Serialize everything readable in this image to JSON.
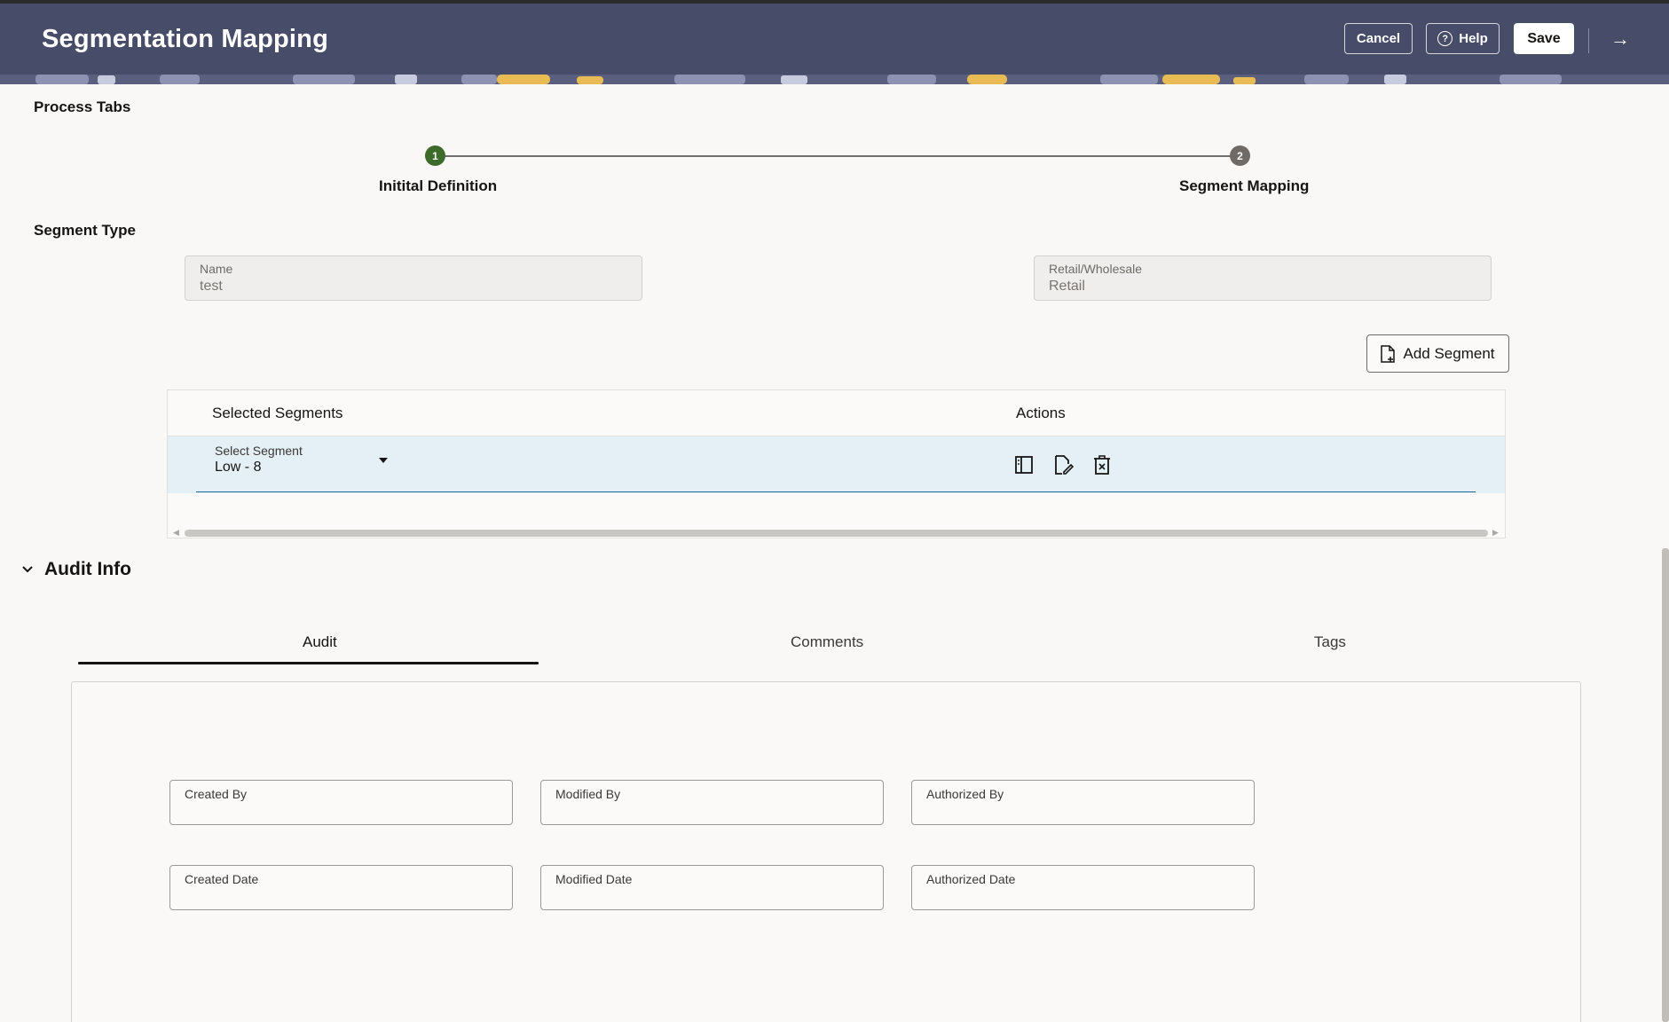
{
  "header": {
    "title": "Segmentation Mapping",
    "cancel_label": "Cancel",
    "help_label": "Help",
    "save_label": "Save",
    "nav_arrow": "→"
  },
  "process_tabs": {
    "title": "Process Tabs",
    "steps": [
      {
        "number": "1",
        "label": "Initital Definition",
        "status": "complete"
      },
      {
        "number": "2",
        "label": "Segment Mapping",
        "status": "current"
      }
    ]
  },
  "segment_type": {
    "title": "Segment Type",
    "name_label": "Name",
    "name_value": "test",
    "retail_label": "Retail/Wholesale",
    "retail_value": "Retail"
  },
  "add_segment_label": "Add Segment",
  "segments_table": {
    "columns": [
      "Selected Segments",
      "Actions"
    ],
    "rows": [
      {
        "select_label": "Select Segment",
        "select_value": "Low - 8",
        "actions": [
          "view-icon",
          "edit-icon",
          "delete-icon"
        ]
      }
    ]
  },
  "audit": {
    "title": "Audit Info",
    "tabs": [
      "Audit",
      "Comments",
      "Tags"
    ],
    "active_tab": "Audit",
    "fields": [
      {
        "label": "Created By",
        "value": ""
      },
      {
        "label": "Modified By",
        "value": ""
      },
      {
        "label": "Authorized By",
        "value": ""
      },
      {
        "label": "Created Date",
        "value": ""
      },
      {
        "label": "Modified Date",
        "value": ""
      },
      {
        "label": "Authorized Date",
        "value": ""
      }
    ]
  },
  "colors": {
    "header_bg": "#474c68",
    "step_complete": "#3d6b2a",
    "step_pending": "#6f6a66",
    "row_selected_bg": "#e5f0f6"
  }
}
